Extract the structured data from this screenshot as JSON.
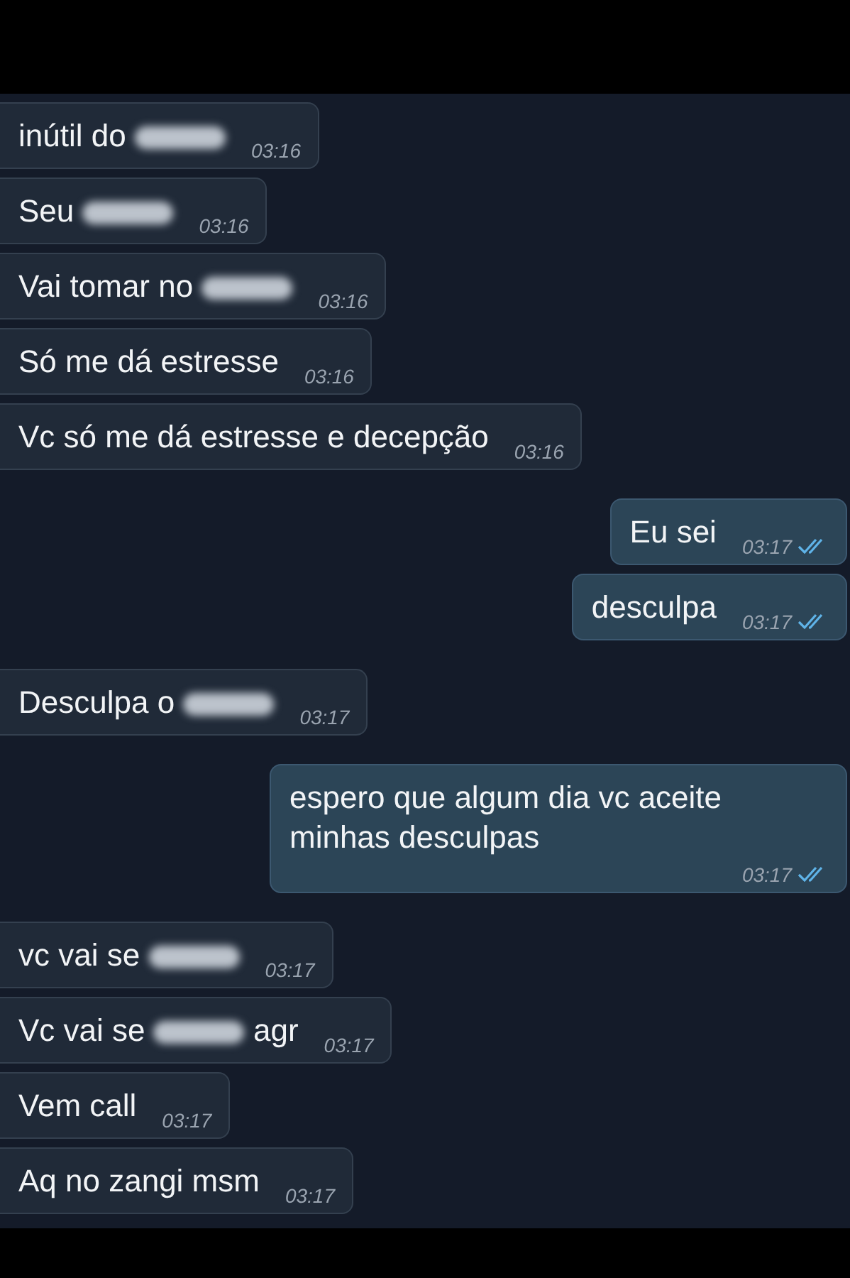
{
  "messages": [
    {
      "kind": "incoming",
      "segments": [
        {
          "kind": "text",
          "text": "inútil do "
        },
        {
          "kind": "blur"
        }
      ],
      "time": "03:16"
    },
    {
      "kind": "incoming",
      "segments": [
        {
          "kind": "text",
          "text": "Seu "
        },
        {
          "kind": "blur"
        }
      ],
      "time": "03:16"
    },
    {
      "kind": "incoming",
      "segments": [
        {
          "kind": "text",
          "text": "Vai tomar no "
        },
        {
          "kind": "blur"
        }
      ],
      "time": "03:16"
    },
    {
      "kind": "incoming",
      "segments": [
        {
          "kind": "text",
          "text": "Só me dá estresse"
        }
      ],
      "time": "03:16"
    },
    {
      "kind": "incoming",
      "segments": [
        {
          "kind": "text",
          "text": "Vc só me dá estresse e decepção"
        }
      ],
      "time": "03:16"
    },
    {
      "kind": "outgoing",
      "segments": [
        {
          "kind": "text",
          "text": "Eu sei"
        }
      ],
      "time": "03:17",
      "read": true
    },
    {
      "kind": "outgoing",
      "segments": [
        {
          "kind": "text",
          "text": "desculpa"
        }
      ],
      "time": "03:17",
      "read": true
    },
    {
      "kind": "incoming",
      "segments": [
        {
          "kind": "text",
          "text": "Desculpa o "
        },
        {
          "kind": "blur"
        }
      ],
      "time": "03:17"
    },
    {
      "kind": "outgoing",
      "segments": [
        {
          "kind": "text",
          "text": "espero que algum dia vc aceite minhas desculpas"
        }
      ],
      "time": "03:17",
      "read": true
    },
    {
      "kind": "incoming",
      "segments": [
        {
          "kind": "text",
          "text": "vc vai se "
        },
        {
          "kind": "blur"
        }
      ],
      "time": "03:17"
    },
    {
      "kind": "incoming",
      "segments": [
        {
          "kind": "text",
          "text": "Vc vai se "
        },
        {
          "kind": "blur"
        },
        {
          "kind": "text",
          "text": " agr"
        }
      ],
      "time": "03:17"
    },
    {
      "kind": "incoming",
      "segments": [
        {
          "kind": "text",
          "text": "Vem call"
        }
      ],
      "time": "03:17"
    },
    {
      "kind": "incoming",
      "segments": [
        {
          "kind": "text",
          "text": "Aq no zangi msm"
        }
      ],
      "time": "03:17"
    }
  ]
}
